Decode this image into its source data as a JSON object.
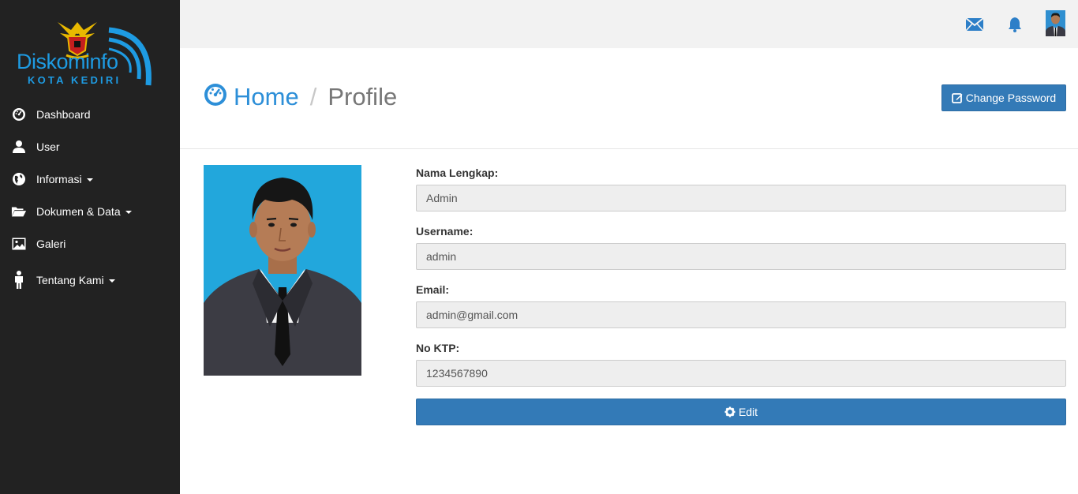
{
  "brand": {
    "name": "Diskominfo",
    "subtitle": "KOTA KEDIRI"
  },
  "sidebar": {
    "items": [
      {
        "label": "Dashboard",
        "icon": "dashboard-icon"
      },
      {
        "label": "User",
        "icon": "user-icon"
      },
      {
        "label": "Informasi",
        "icon": "globe-icon",
        "dropdown": true
      },
      {
        "label": "Dokumen & Data",
        "icon": "folder-open-icon",
        "dropdown": true
      },
      {
        "label": "Galeri",
        "icon": "picture-icon"
      },
      {
        "label": "Tentang Kami",
        "icon": "person-icon",
        "dropdown": true
      }
    ]
  },
  "topbar": {
    "icons": [
      "envelope-icon",
      "bell-icon",
      "user-avatar"
    ]
  },
  "breadcrumb": {
    "home": "Home",
    "separator": "/",
    "current": "Profile"
  },
  "actions": {
    "change_password": "Change Password",
    "edit": "Edit"
  },
  "profile": {
    "fields": [
      {
        "label": "Nama Lengkap:",
        "value": "Admin"
      },
      {
        "label": "Username:",
        "value": "admin"
      },
      {
        "label": "Email:",
        "value": "admin@gmail.com"
      },
      {
        "label": "No KTP:",
        "value": "1234567890"
      }
    ]
  },
  "colors": {
    "sidebar_bg": "#222222",
    "topbar_bg": "#f2f2f2",
    "primary": "#337ab7",
    "link_blue": "#2d8fd8",
    "brand_blue": "#1e9be2"
  }
}
